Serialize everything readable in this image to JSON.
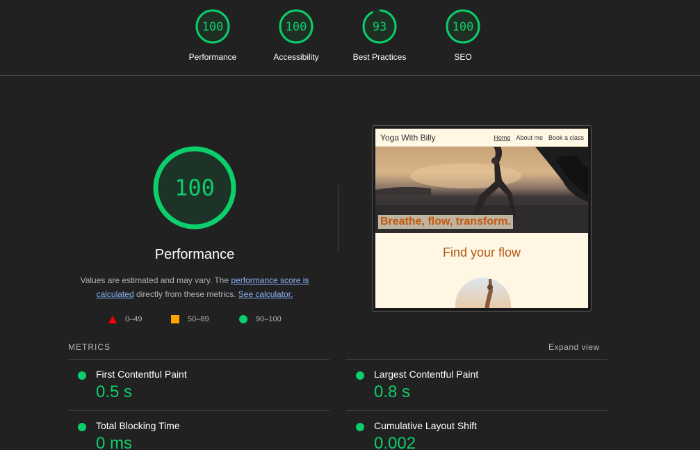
{
  "gauges": [
    {
      "score": "100",
      "label": "Performance",
      "fraction": 1.0
    },
    {
      "score": "100",
      "label": "Accessibility",
      "fraction": 1.0
    },
    {
      "score": "93",
      "label": "Best Practices",
      "fraction": 0.93
    },
    {
      "score": "100",
      "label": "SEO",
      "fraction": 1.0
    }
  ],
  "main": {
    "score": "100",
    "fraction": 1.0,
    "title": "Performance",
    "desc_before": "Values are estimated and may vary. The ",
    "link_score": "performance score is calculated",
    "desc_middle": " directly from these metrics. ",
    "link_calc": "See calculator."
  },
  "legend": {
    "fail": "0–49",
    "average": "50–89",
    "pass": "90–100"
  },
  "screenshot": {
    "brand": "Yoga With Billy",
    "nav": [
      "Home",
      "About me",
      "Book a class"
    ],
    "tagline": "Breathe, flow, transform.",
    "heading": "Find your flow"
  },
  "metrics": {
    "header": "METRICS",
    "expand": "Expand view",
    "items": [
      {
        "name": "First Contentful Paint",
        "value": "0.5 s"
      },
      {
        "name": "Largest Contentful Paint",
        "value": "0.8 s"
      },
      {
        "name": "Total Blocking Time",
        "value": "0 ms"
      },
      {
        "name": "Cumulative Layout Shift",
        "value": "0.002"
      }
    ]
  },
  "colors": {
    "pass": "#0cce6b",
    "average": "#ffa400",
    "fail": "#ff0000",
    "background": "#212121"
  }
}
